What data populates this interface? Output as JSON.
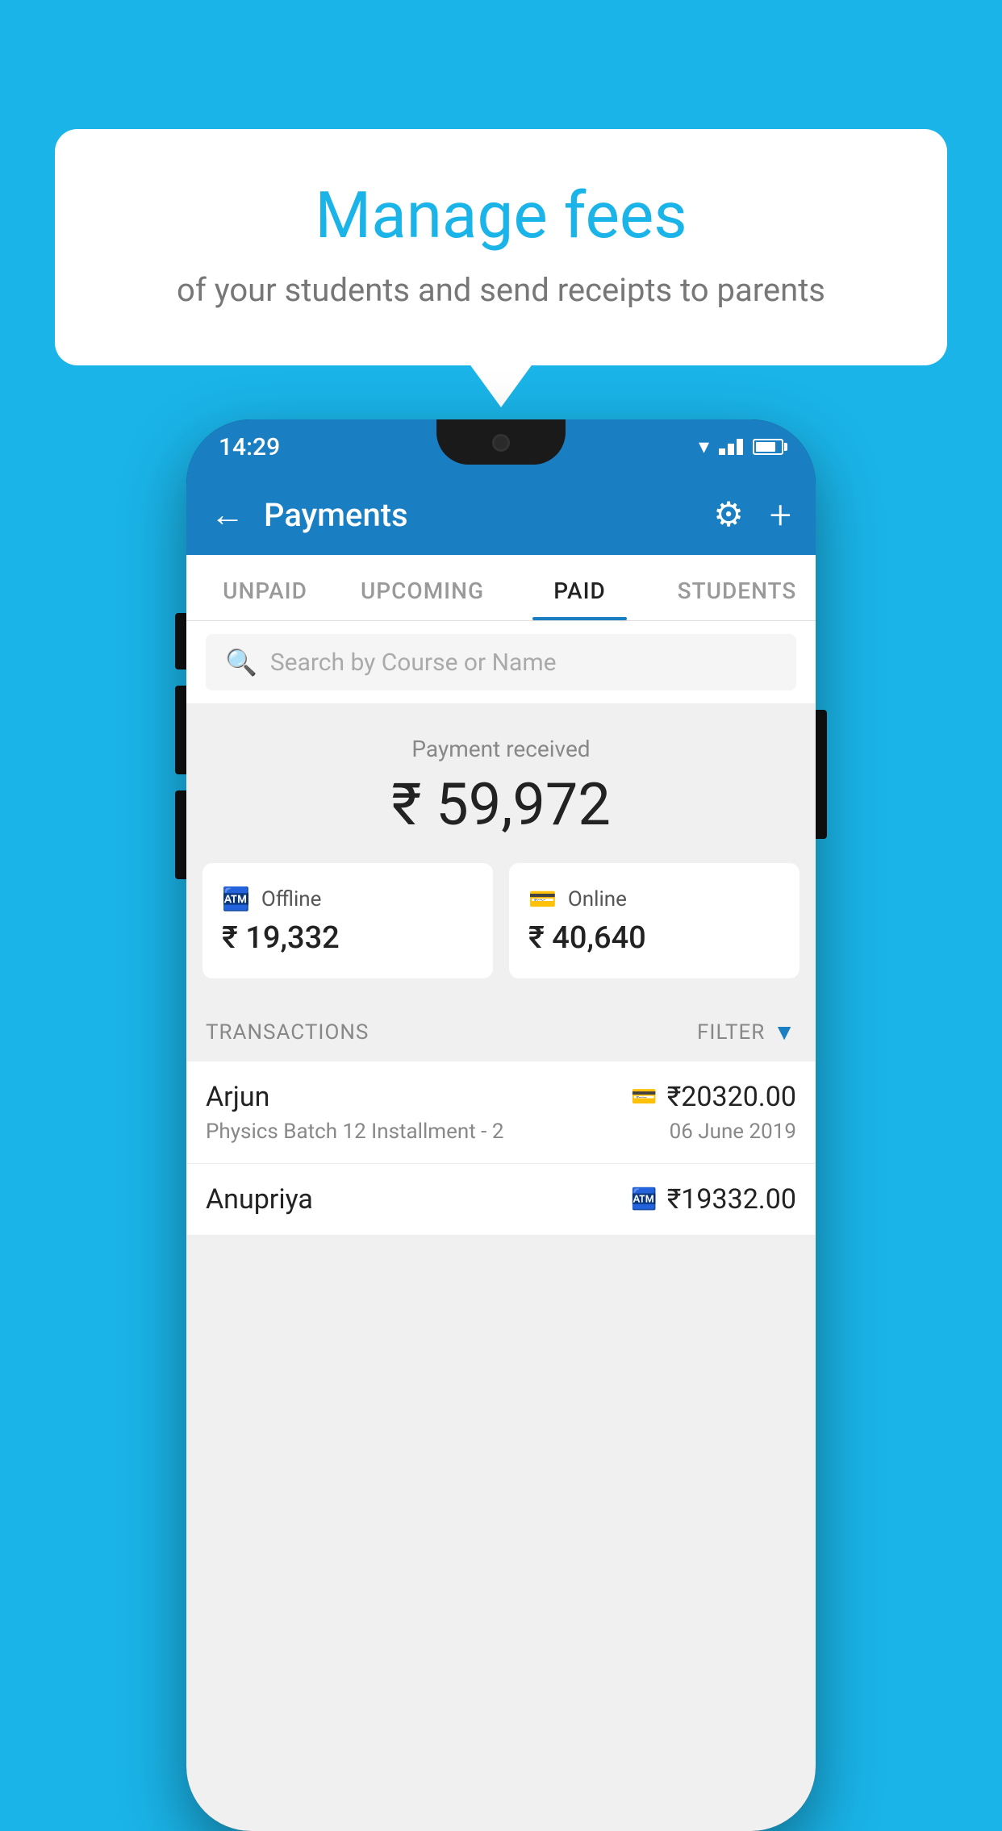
{
  "background": {
    "color": "#1ab4e8"
  },
  "speech_bubble": {
    "title": "Manage fees",
    "subtitle": "of your students and send receipts to parents"
  },
  "status_bar": {
    "time": "14:29"
  },
  "app_bar": {
    "title": "Payments",
    "back_label": "←",
    "gear_label": "⚙",
    "plus_label": "+"
  },
  "tabs": [
    {
      "label": "UNPAID",
      "active": false
    },
    {
      "label": "UPCOMING",
      "active": false
    },
    {
      "label": "PAID",
      "active": true
    },
    {
      "label": "STUDENTS",
      "active": false
    }
  ],
  "search": {
    "placeholder": "Search by Course or Name"
  },
  "payment_received": {
    "label": "Payment received",
    "amount": "₹ 59,972"
  },
  "payment_cards": {
    "offline": {
      "label": "Offline",
      "amount": "₹ 19,332"
    },
    "online": {
      "label": "Online",
      "amount": "₹ 40,640"
    }
  },
  "transactions": {
    "header_label": "TRANSACTIONS",
    "filter_label": "FILTER",
    "rows": [
      {
        "name": "Arjun",
        "amount": "₹20320.00",
        "payment_type": "card",
        "course": "Physics Batch 12 Installment - 2",
        "date": "06 June 2019"
      },
      {
        "name": "Anupriya",
        "amount": "₹19332.00",
        "payment_type": "cash",
        "course": "",
        "date": ""
      }
    ]
  }
}
